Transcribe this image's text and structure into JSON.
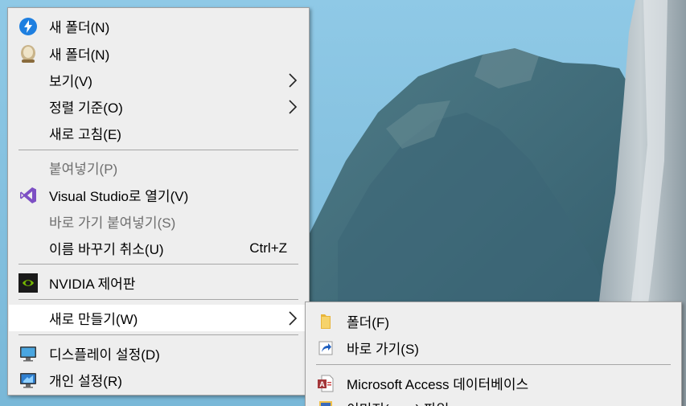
{
  "context_menu": {
    "items": [
      {
        "label": "새 폴더(N)",
        "icon": "bolt-folder-icon",
        "type": "item"
      },
      {
        "label": "새 폴더(N)",
        "icon": "person-avatar-icon",
        "type": "item"
      },
      {
        "label": "보기(V)",
        "type": "submenu"
      },
      {
        "label": "정렬 기준(O)",
        "type": "submenu"
      },
      {
        "label": "새로 고침(E)",
        "type": "item"
      },
      {
        "label": "붙여넣기(P)",
        "type": "disabled"
      },
      {
        "label": "Visual Studio로 열기(V)",
        "icon": "visual-studio-icon",
        "type": "item"
      },
      {
        "label": "바로 가기 붙여넣기(S)",
        "type": "disabled"
      },
      {
        "label": "이름 바꾸기 취소(U)",
        "shortcut": "Ctrl+Z",
        "type": "item"
      },
      {
        "label": "NVIDIA 제어판",
        "icon": "nvidia-icon",
        "type": "item"
      },
      {
        "label": "새로 만들기(W)",
        "type": "submenu",
        "state": "highlighted"
      },
      {
        "label": "디스플레이 설정(D)",
        "icon": "display-icon",
        "type": "item"
      },
      {
        "label": "개인 설정(R)",
        "icon": "personalize-icon",
        "type": "item"
      }
    ]
  },
  "new_submenu": {
    "items": [
      {
        "label": "폴더(F)",
        "icon": "folder-icon"
      },
      {
        "label": "바로 가기(S)",
        "icon": "shortcut-icon"
      },
      {
        "label": "Microsoft Access 데이터베이스",
        "icon": "access-icon"
      },
      {
        "label": "이미지(.png) 파일",
        "icon": "image-file-icon",
        "state": "partially-visible"
      }
    ]
  },
  "colors": {
    "menu_background": "#eeeeee",
    "menu_border": "#a0a0a0",
    "highlight": "#ffffff",
    "disabled_text": "#6d6d6d",
    "separator": "#a6a6a6"
  }
}
